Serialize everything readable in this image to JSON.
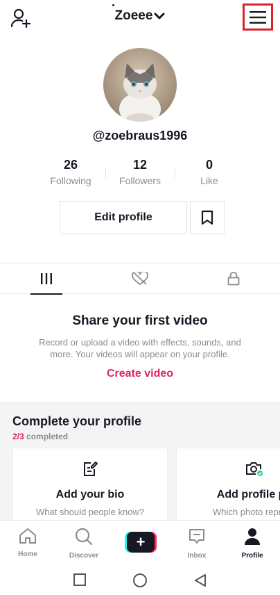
{
  "header": {
    "title": "Zoeee"
  },
  "profile": {
    "username": "@zoebraus1996",
    "stats": [
      {
        "value": "26",
        "label": "Following"
      },
      {
        "value": "12",
        "label": "Followers"
      },
      {
        "value": "0",
        "label": "Like"
      }
    ],
    "edit_label": "Edit profile"
  },
  "tabs": [
    "videos-grid-icon",
    "liked-icon",
    "private-lock-icon"
  ],
  "empty_state": {
    "title": "Share your first video",
    "description": "Record or upload a video with effects, sounds, and more. Your videos will appear on your profile.",
    "cta": "Create video"
  },
  "complete_profile": {
    "title": "Complete your profile",
    "progress_done": "2/3",
    "progress_label": "completed",
    "cards": [
      {
        "title": "Add your bio",
        "subtitle": "What should people know?",
        "icon": "edit-note-icon"
      },
      {
        "title": "Add profile ph",
        "subtitle": "Which photo represe",
        "icon": "camera-icon"
      }
    ]
  },
  "nav": {
    "home": "Home",
    "discover": "Discover",
    "inbox": "Inbox",
    "profile": "Profile"
  },
  "colors": {
    "accent": "#e0245e",
    "highlight_box": "#d9232d",
    "text": "#161823",
    "muted": "#8a8b91"
  }
}
